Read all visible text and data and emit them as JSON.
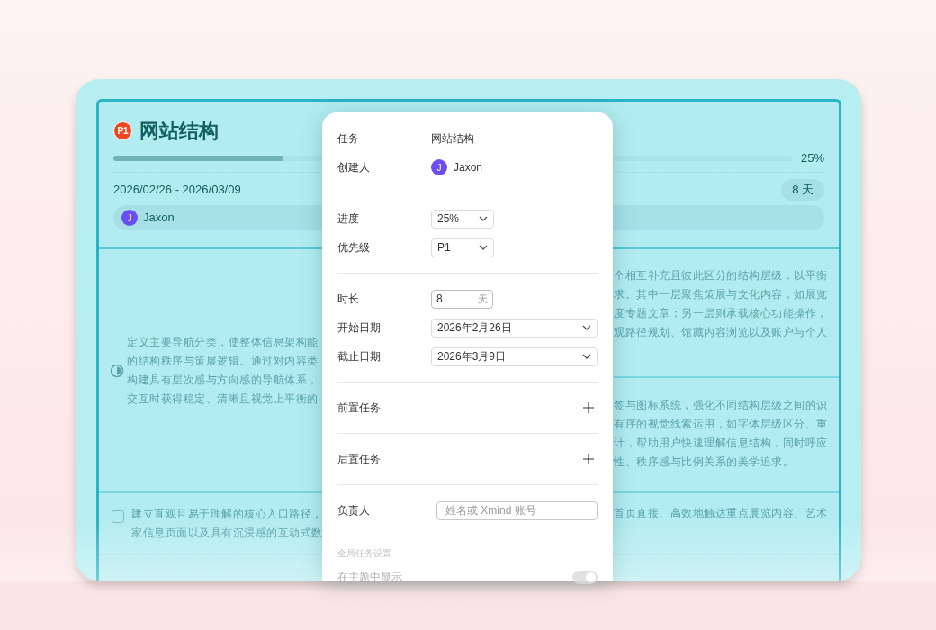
{
  "task_card": {
    "priority": "P1",
    "title": "网站结构",
    "progress": {
      "level": 0.25,
      "reading": "25%"
    },
    "date_range": "2026/02/26 - 2026/03/09",
    "duration": "8 天",
    "assignee": {
      "initial": "J",
      "name": "Jaxon"
    }
  },
  "outline_rows": [
    {
      "kind": "in_progress",
      "left_lines": [
        "定义主要导航分类，使整体信息架构能",
        "的结构秩序与策展逻辑。通过对内容类",
        "构建具有层次感与方向感的导航体系，",
        "交互时获得稳定、清晰且视觉上平衡的"
      ],
      "right_cells": [
        [
          "个相互补充且彼此区分的结构层级，以平衡",
          "求。其中一层聚焦策展与文化内容，如展览",
          "度专题文章；另一层则承载核心功能操作，",
          "观路径规划、馆藏内容浏览以及账户与个人"
        ],
        [
          "签与图标系统，强化不同结构层级之间的识",
          "有序的视觉线索运用，如字体层级区分、重",
          "计，帮助用户快速理解信息结构，同时呼应",
          "性、秩序感与比例关系的美学追求。"
        ]
      ]
    },
    {
      "kind": "todo",
      "checked": false,
      "left_lines": [
        "建立直观且易于理解的核心入口路径，",
        "家信息页面以及具有沉浸感的互动式数"
      ],
      "right_cells": [
        [
          "首页直接、高效地触达重点展览内容、艺术"
        ]
      ]
    }
  ],
  "task_panel": {
    "groups": [
      [
        {
          "kind": "text",
          "label": "任务",
          "value": "网站结构"
        },
        {
          "kind": "person",
          "label": "创建人",
          "initial": "J",
          "value": "Jaxon"
        }
      ],
      [
        {
          "kind": "select",
          "label": "进度",
          "value": "25%"
        },
        {
          "kind": "select",
          "label": "优先级",
          "value": "P1"
        }
      ],
      [
        {
          "kind": "duration",
          "label": "时长",
          "value": "8",
          "unit": "天"
        },
        {
          "kind": "date",
          "label": "开始日期",
          "value": "2026年2月26日"
        },
        {
          "kind": "date",
          "label": "截止日期",
          "value": "2026年3月9日"
        }
      ],
      [
        {
          "kind": "add",
          "label": "前置任务"
        }
      ],
      [
        {
          "kind": "add",
          "label": "后置任务"
        }
      ],
      [
        {
          "kind": "input",
          "label": "负责人",
          "placeholder": "姓名或 Xmind 账号"
        }
      ]
    ],
    "global_settings": {
      "title": "全局任务设置",
      "items": [
        {
          "label": "在主题中显示",
          "on": true
        }
      ]
    }
  }
}
